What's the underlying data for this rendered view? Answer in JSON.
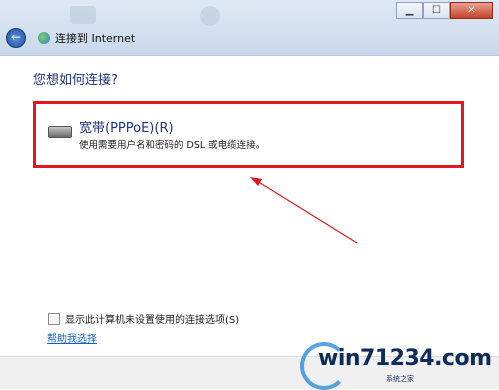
{
  "window": {
    "minimize_glyph": "▁",
    "maximize_glyph": "☐",
    "close_glyph": "✕"
  },
  "nav": {
    "back_glyph": "←",
    "title": "连接到 Internet"
  },
  "main": {
    "question": "您想如何连接?",
    "option": {
      "title": "宽带(PPPoE)(R)",
      "description": "使用需要用户名和密码的 DSL 或电缆连接。",
      "icon": "modem-icon"
    },
    "checkbox_label": "显示此计算机未设置使用的连接选项(S)",
    "help_link": "帮助我选择"
  },
  "annotation": {
    "highlight_color": "#e0181f",
    "arrow_color": "#e0181f"
  },
  "watermark": {
    "text": "win71234.com",
    "subtext": "系统之家"
  }
}
